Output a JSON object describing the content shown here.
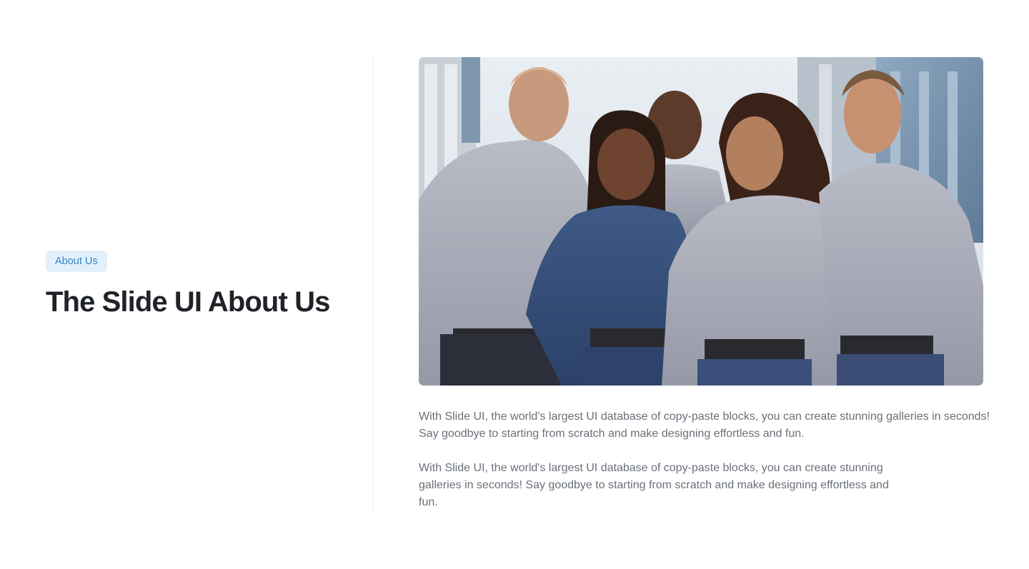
{
  "section": {
    "badge": "About Us",
    "title": "The Slide UI About Us"
  },
  "hero_image": {
    "alt": "Team photo"
  },
  "paragraphs": {
    "first": "With Slide UI, the world's largest UI database of copy-paste blocks, you can create stunning galleries in seconds! Say goodbye to starting from scratch and make designing effortless and fun.",
    "second": "With Slide UI, the world's largest UI database of copy-paste blocks, you can create stunning galleries in seconds! Say goodbye to starting from scratch and make designing effortless and fun."
  },
  "colors": {
    "badge_bg": "#e3f0fb",
    "badge_text": "#2f86c8",
    "title": "#1f2328",
    "body_text": "#6a7079",
    "divider": "#ececec"
  }
}
